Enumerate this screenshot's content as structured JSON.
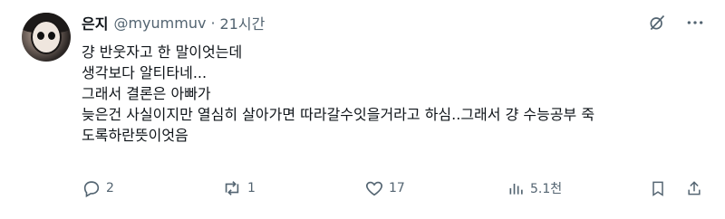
{
  "author": {
    "name": "은지",
    "handle": "@myummuv",
    "separator": "·",
    "time": "21시간"
  },
  "tweet": {
    "lines": [
      "걍 반웃자고 한 말이엇는데",
      "생각보다 알티타네...",
      "그래서 결론은 아빠가",
      "늦은건 사실이지만 열심히 살아가면 따라갈수잇을거라고 하심..그래서 걍 수능공부 죽",
      "도록하란뜻이엇음"
    ]
  },
  "top_icons": [
    "grok-icon",
    "more-icon"
  ],
  "actions": {
    "reply_count": "2",
    "retweet_count": "1",
    "like_count": "17",
    "views_count": "5.1천"
  },
  "colors": {
    "text": "#0f1419",
    "muted": "#536471"
  }
}
